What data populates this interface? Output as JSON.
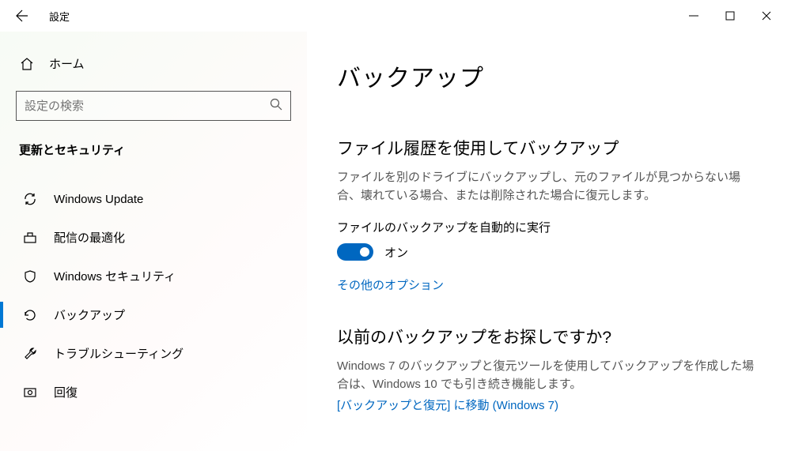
{
  "titlebar": {
    "title": "設定"
  },
  "sidebar": {
    "home": "ホーム",
    "searchPlaceholder": "設定の検索",
    "sectionHeader": "更新とセキュリティ",
    "items": [
      {
        "label": "Windows Update"
      },
      {
        "label": "配信の最適化"
      },
      {
        "label": "Windows セキュリティ"
      },
      {
        "label": "バックアップ"
      },
      {
        "label": "トラブルシューティング"
      },
      {
        "label": "回復"
      }
    ]
  },
  "content": {
    "pageTitle": "バックアップ",
    "s1": {
      "heading": "ファイル履歴を使用してバックアップ",
      "desc": "ファイルを別のドライブにバックアップし、元のファイルが見つからない場合、壊れている場合、または削除された場合に復元します。",
      "toggleLabel": "ファイルのバックアップを自動的に実行",
      "toggleState": "オン",
      "link": "その他のオプション"
    },
    "s2": {
      "heading": "以前のバックアップをお探しですか?",
      "desc": "Windows 7 のバックアップと復元ツールを使用してバックアップを作成した場合は、Windows 10 でも引き続き機能します。",
      "link": "[バックアップと復元] に移動 (Windows 7)"
    }
  }
}
